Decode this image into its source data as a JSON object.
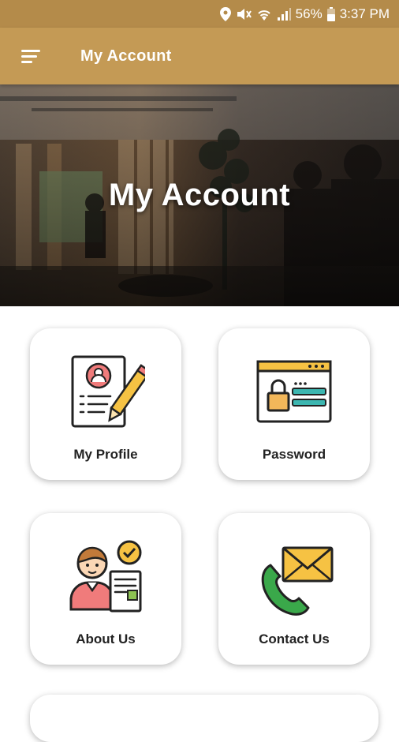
{
  "status_bar": {
    "battery": "56%",
    "time": "3:37 PM"
  },
  "app_bar": {
    "title": "My Account"
  },
  "hero": {
    "title": "My Account"
  },
  "cards": {
    "profile": "My Profile",
    "password": "Password",
    "about": "About Us",
    "contact": "Contact Us"
  },
  "colors": {
    "status_bar": "#b48b4a",
    "app_bar": "#c49a55"
  },
  "icons": {
    "profile": "profile-document-pencil-icon",
    "password": "password-lock-window-icon",
    "about": "person-checkmark-icon",
    "contact": "phone-envelope-icon"
  }
}
